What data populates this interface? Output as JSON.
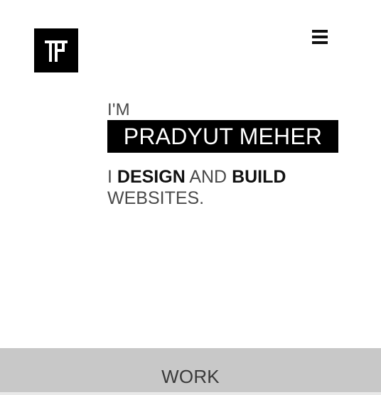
{
  "header": {
    "logo_icon": "tp-monogram-logo",
    "menu_icon": "hamburger-menu-icon"
  },
  "hero": {
    "prefix": "I'M",
    "name": "PRADYUT MEHER",
    "tagline": {
      "part1": "I ",
      "part2": "DESIGN",
      "part3": " AND ",
      "part4": "BUILD",
      "part5": "WEBSITES."
    }
  },
  "work": {
    "label": "WORK"
  },
  "colors": {
    "background": "#ffffff",
    "logo_background": "#000000",
    "name_background": "#000000",
    "name_text": "#ffffff",
    "work_background": "#c8c8c8",
    "body_text": "#4a4a4a",
    "strong_text": "#111111"
  }
}
